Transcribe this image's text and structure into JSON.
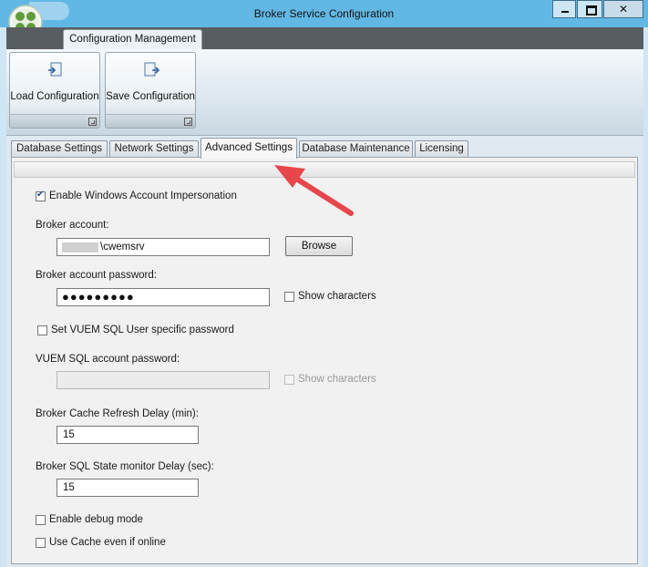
{
  "window": {
    "title": "Broker Service Configuration",
    "controls": {
      "minimize": "–",
      "maximize": "□",
      "close": "✕"
    }
  },
  "ribbon": {
    "tab_label": "Configuration Management",
    "buttons": [
      {
        "label": "Load Configuration",
        "icon": "load-config-icon"
      },
      {
        "label": "Save Configuration",
        "icon": "save-config-icon"
      }
    ]
  },
  "tabs": [
    {
      "label": "Database Settings",
      "active": false
    },
    {
      "label": "Network Settings",
      "active": false
    },
    {
      "label": "Advanced Settings",
      "active": true
    },
    {
      "label": "Database Maintenance",
      "active": false
    },
    {
      "label": "Licensing",
      "active": false
    }
  ],
  "advanced": {
    "impersonation": {
      "label": "Enable Windows Account Impersonation",
      "checked": true
    },
    "broker_account": {
      "label": "Broker account:",
      "value": "\\cwemsrv",
      "browse_label": "Browse"
    },
    "broker_password": {
      "label": "Broker account password:",
      "value": "●●●●●●●●●",
      "show_chars": "Show characters"
    },
    "vuem_specific": {
      "label": "Set VUEM SQL User specific password",
      "checked": false
    },
    "vuem_password": {
      "label": "VUEM SQL account password:",
      "value": "",
      "show_chars": "Show characters"
    },
    "cache_refresh": {
      "label": "Broker Cache Refresh Delay (min):",
      "value": "15"
    },
    "sql_state": {
      "label": "Broker SQL State monitor Delay (sec):",
      "value": "15"
    },
    "debug_mode": {
      "label": "Enable debug mode",
      "checked": false
    },
    "use_cache": {
      "label": "Use Cache even if online",
      "checked": false
    }
  },
  "colors": {
    "titlebar": "#62b8e4",
    "ribbon_header": "#585d61",
    "arrow": "#e8464a"
  }
}
